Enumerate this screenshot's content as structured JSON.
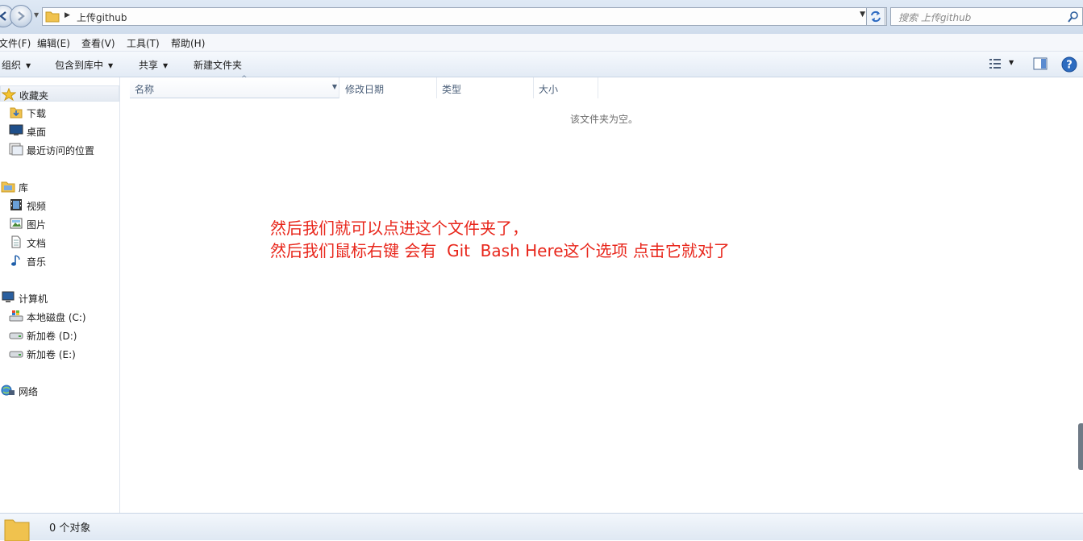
{
  "address_bar": {
    "path": "上传github",
    "search_placeholder": "搜索 上传github"
  },
  "menu": {
    "items": [
      "文件(F)",
      "编辑(E)",
      "查看(V)",
      "工具(T)",
      "帮助(H)"
    ]
  },
  "toolbar": {
    "organize": "组织",
    "include_in_library": "包含到库中",
    "share": "共享",
    "new_folder": "新建文件夹"
  },
  "nav": {
    "favorites": "收藏夹",
    "downloads": "下载",
    "desktop": "桌面",
    "recent": "最近访问的位置",
    "libraries": "库",
    "videos": "视频",
    "pictures": "图片",
    "documents": "文档",
    "music": "音乐",
    "computer": "计算机",
    "drive_c": "本地磁盘 (C:)",
    "drive_d": "新加卷 (D:)",
    "drive_e": "新加卷 (E:)",
    "network": "网络"
  },
  "columns": {
    "name": "名称",
    "modified": "修改日期",
    "type": "类型",
    "size": "大小"
  },
  "content": {
    "empty_message": "该文件夹为空。",
    "annotation_line1": "然后我们就可以点进这个文件夹了，",
    "annotation_line2": "然后我们鼠标右键 会有  Git  Bash Here这个选项 点击它就对了"
  },
  "status": {
    "item_count": "0 个对象"
  },
  "colors": {
    "annotation_red": "#e8261b",
    "chrome_blue": "#dfe9f5"
  }
}
